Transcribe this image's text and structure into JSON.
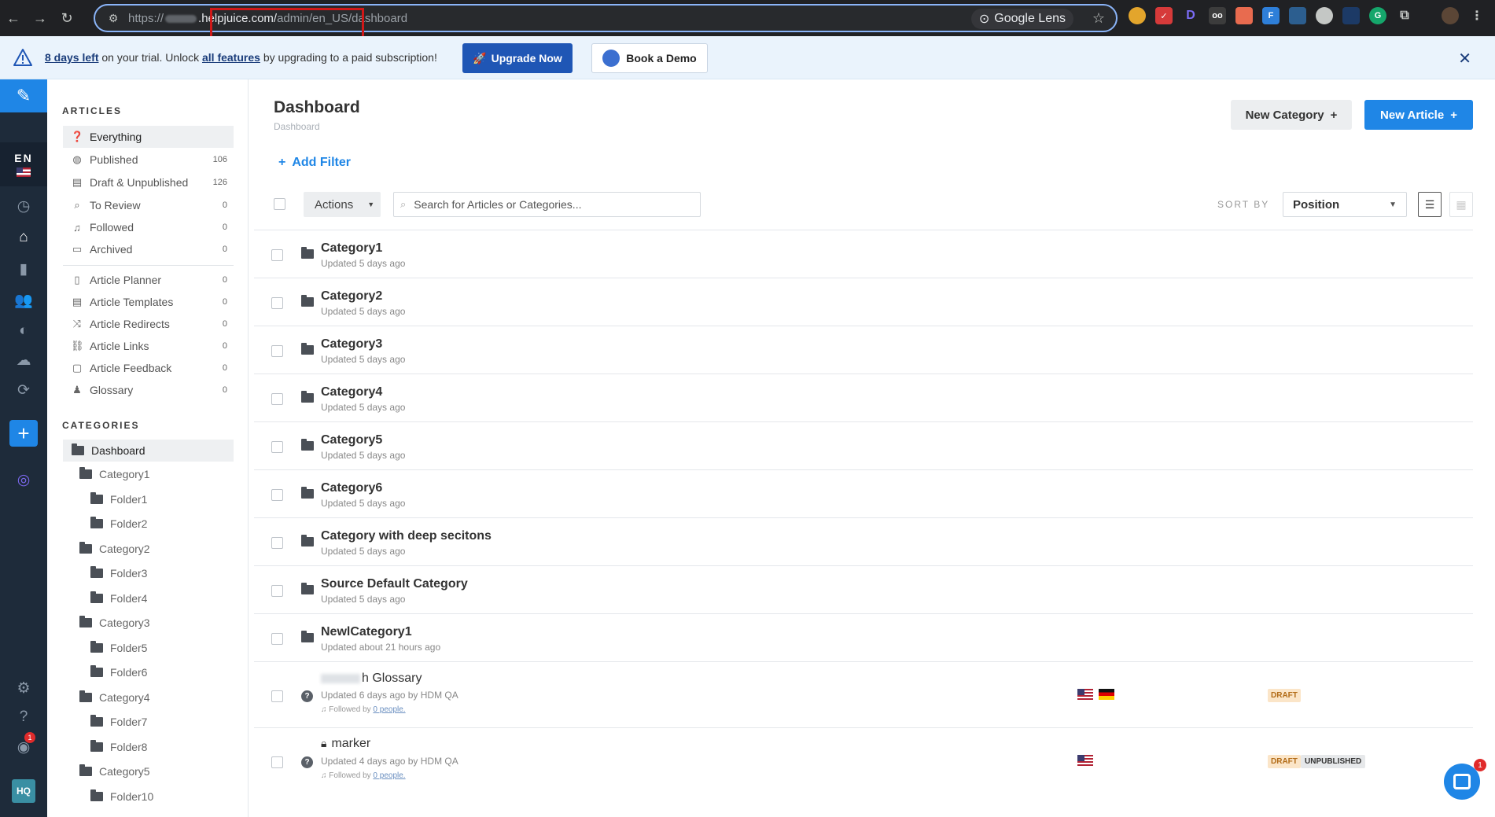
{
  "browser": {
    "url_prefix": "https://",
    "url_host": ".helpjuice.com/",
    "url_path": "admin/en_US/dashboard",
    "lens_label": "Google Lens"
  },
  "trial": {
    "days_left": "8 days left",
    "text_1": "on your trial. Unlock",
    "all_features": "all features",
    "text_2": "by upgrading to a paid subscription!",
    "upgrade_label": "Upgrade Now",
    "demo_label": "Book a Demo"
  },
  "rail": {
    "lang": "EN",
    "hq": "HQ",
    "notif_count": "1"
  },
  "sidebar": {
    "articles_heading": "ARTICLES",
    "items": [
      {
        "label": "Everything",
        "count": "",
        "icon": "question-circle-icon"
      },
      {
        "label": "Published",
        "count": "106",
        "icon": "globe-icon"
      },
      {
        "label": "Draft & Unpublished",
        "count": "126",
        "icon": "draft-icon"
      },
      {
        "label": "To Review",
        "count": "0",
        "icon": "review-icon"
      },
      {
        "label": "Followed",
        "count": "0",
        "icon": "bell-icon"
      },
      {
        "label": "Archived",
        "count": "0",
        "icon": "archive-icon"
      }
    ],
    "tools": [
      {
        "label": "Article Planner",
        "count": "0",
        "icon": "book-icon"
      },
      {
        "label": "Article Templates",
        "count": "0",
        "icon": "template-icon"
      },
      {
        "label": "Article Redirects",
        "count": "0",
        "icon": "shuffle-icon"
      },
      {
        "label": "Article Links",
        "count": "0",
        "icon": "link-icon"
      },
      {
        "label": "Article Feedback",
        "count": "0",
        "icon": "comment-icon"
      },
      {
        "label": "Glossary",
        "count": "0",
        "icon": "glossary-icon"
      }
    ],
    "categories_heading": "CATEGORIES",
    "tree": [
      {
        "label": "Dashboard",
        "level": 0
      },
      {
        "label": "Category1",
        "level": 1
      },
      {
        "label": "Folder1",
        "level": 2
      },
      {
        "label": "Folder2",
        "level": 2
      },
      {
        "label": "Category2",
        "level": 1
      },
      {
        "label": "Folder3",
        "level": 2
      },
      {
        "label": "Folder4",
        "level": 2
      },
      {
        "label": "Category3",
        "level": 1
      },
      {
        "label": "Folder5",
        "level": 2
      },
      {
        "label": "Folder6",
        "level": 2
      },
      {
        "label": "Category4",
        "level": 1
      },
      {
        "label": "Folder7",
        "level": 2
      },
      {
        "label": "Folder8",
        "level": 2
      },
      {
        "label": "Category5",
        "level": 1
      },
      {
        "label": "Folder10",
        "level": 2
      }
    ]
  },
  "main": {
    "title": "Dashboard",
    "breadcrumb": "Dashboard",
    "new_category": "New Category",
    "new_article": "New Article",
    "add_filter": "Add Filter",
    "actions": "Actions",
    "search_placeholder": "Search for Articles or Categories...",
    "sort_by": "SORT BY",
    "sort_value": "Position"
  },
  "rows": [
    {
      "title": "Category1",
      "sub": "Updated 5 days ago"
    },
    {
      "title": "Category2",
      "sub": "Updated 5 days ago"
    },
    {
      "title": "Category3",
      "sub": "Updated 5 days ago"
    },
    {
      "title": "Category4",
      "sub": "Updated 5 days ago"
    },
    {
      "title": "Category5",
      "sub": "Updated 5 days ago"
    },
    {
      "title": "Category6",
      "sub": "Updated 5 days ago"
    },
    {
      "title": "Category with deep secitons",
      "sub": "Updated 5 days ago"
    },
    {
      "title": "Source Default Category",
      "sub": "Updated 5 days ago"
    },
    {
      "title": "NewlCategory1",
      "sub": "Updated about 21 hours ago"
    }
  ],
  "articles": [
    {
      "title": "h Glossary",
      "sub": "Updated 6 days ago by HDM QA",
      "followed_prefix": "Followed by",
      "followed_link": "0 people.",
      "badge_draft": "DRAFT",
      "badge_unpub": ""
    },
    {
      "title": "marker",
      "sub": "Updated 4 days ago by HDM QA",
      "followed_prefix": "Followed by",
      "followed_link": "0 people.",
      "badge_draft": "DRAFT",
      "badge_unpub": "UNPUBLISHED"
    }
  ],
  "chat": {
    "badge": "1"
  }
}
